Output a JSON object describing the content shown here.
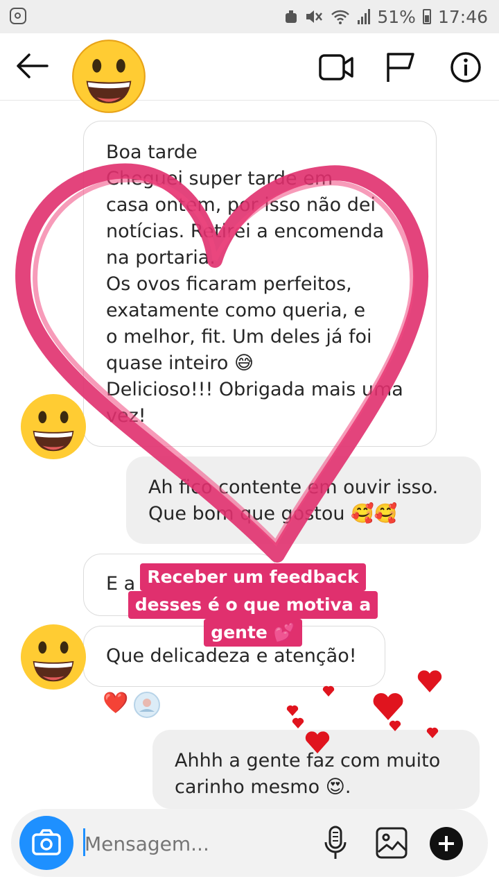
{
  "status_bar": {
    "battery": "51%",
    "time": "17:46"
  },
  "header": {
    "icons": [
      "back-arrow-icon",
      "video-call-icon",
      "flag-icon",
      "info-icon"
    ]
  },
  "messages": {
    "m1_lines": [
      "Boa tarde",
      "Cheguei super tarde em",
      "casa ontem, por isso não dei",
      "notícias. Retirei a encomenda",
      "na portaria.",
      "Os ovos ficaram perfeitos,",
      "exatamente como queria, e",
      "o melhor, fit. Um deles já foi",
      "quase inteiro 😅",
      "Delicioso!!! Obrigada mais uma",
      "vez!"
    ],
    "m2_lines": [
      "Ah fico contente em ouvir isso.",
      "Que bom que gostou 🥰🥰"
    ],
    "m3_text": "E a",
    "m4_text": "Que delicadeza e atenção!",
    "m5_lines": [
      "Ahhh a gente faz com muito",
      "carinho mesmo 😍."
    ]
  },
  "reactions": {
    "heart": "❤️"
  },
  "caption": {
    "lines": [
      "Receber um feedback",
      "desses é o que motiva a",
      "gente 💕"
    ]
  },
  "composer": {
    "placeholder": "Mensagem..."
  },
  "colors": {
    "accent": "#1e90ff",
    "heart_pink": "#e0306e",
    "heart_red": "#e0141e"
  }
}
